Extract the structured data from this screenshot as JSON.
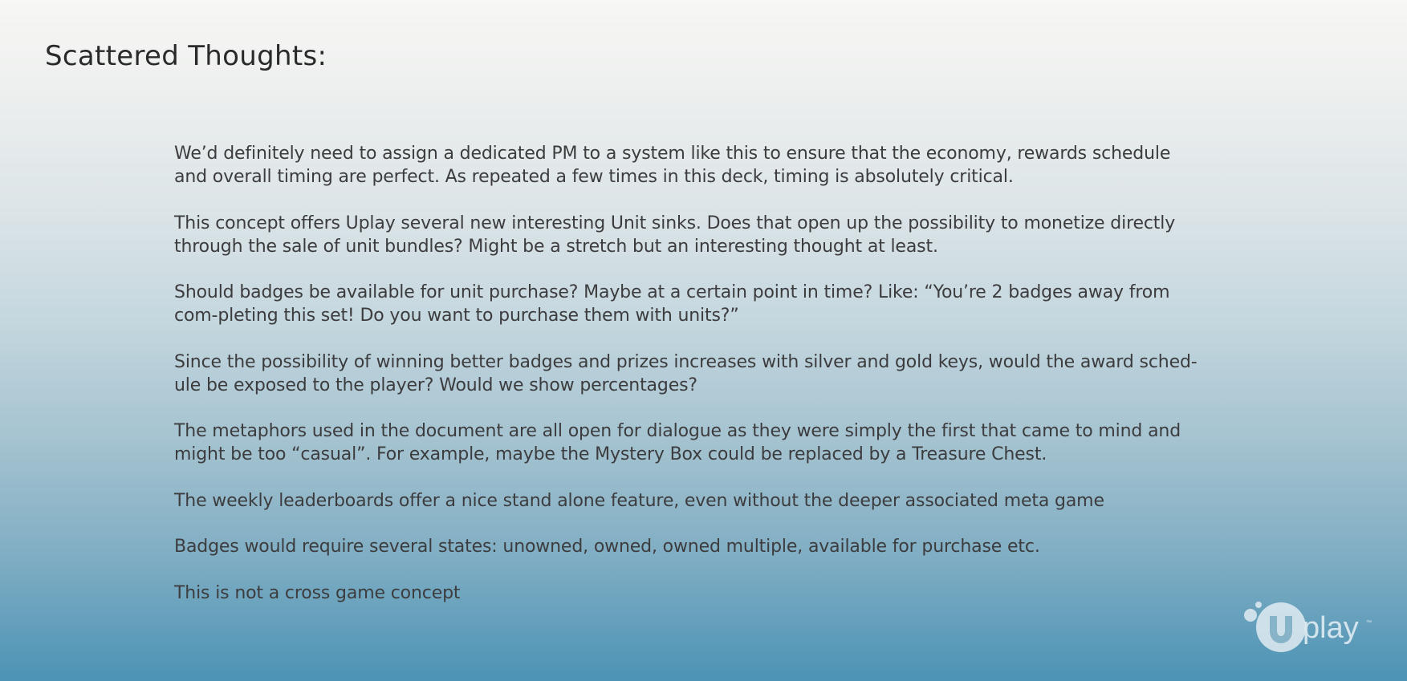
{
  "slide": {
    "title": "Scattered Thoughts:",
    "paragraphs": [
      "We’d definitely need to assign a dedicated PM to a system like this to ensure that the economy, rewards schedule and overall timing are perfect. As repeated a few times in this deck, timing is absolutely critical.",
      "This concept offers Uplay several new interesting Unit sinks. Does that open up the possibility to monetize directly through the sale of unit bundles? Might be a stretch but an interesting thought at least.",
      "Should badges be available for unit purchase? Maybe at a certain point in time? Like: “You’re 2 badges away from com-pleting this set! Do you want to purchase them with units?”",
      "Since the possibility of winning better badges and prizes increases with silver and gold keys, would the award sched-ule be exposed to the player? Would we show percentages?",
      "The metaphors used in the document are all open for dialogue as they were simply the first that came to mind and might be too “casual”. For example, maybe the Mystery Box could be replaced by a Treasure Chest.",
      "The weekly leaderboards offer a nice stand alone feature, even without the deeper associated meta game",
      "Badges would require several states: unowned, owned, owned multiple, available for purchase etc.",
      "This is not a cross game concept"
    ]
  },
  "logo": {
    "text": "play",
    "icon": "uplay-logo-icon",
    "color": "#e1ecf2"
  },
  "colors": {
    "gradient_top": "#f7f7f5",
    "gradient_bottom": "#4c93b5",
    "text": "#3c3c3e",
    "title": "#2a2a2a"
  }
}
